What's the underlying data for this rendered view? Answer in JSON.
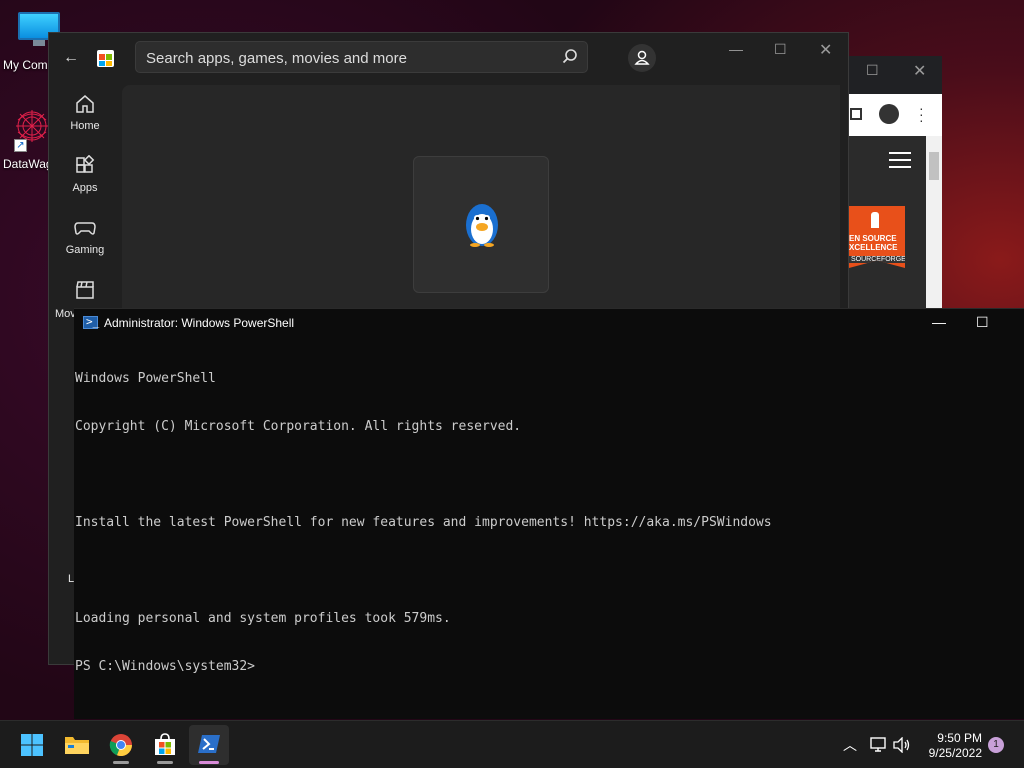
{
  "desktop": {
    "icons": [
      {
        "label": "My Com",
        "icon": "monitor-icon"
      },
      {
        "label": "DataWag",
        "icon": "datawag-icon"
      }
    ]
  },
  "store": {
    "search_placeholder": "Search apps, games, movies and more",
    "nav": [
      {
        "label": "Home",
        "icon": "home-icon"
      },
      {
        "label": "Apps",
        "icon": "apps-icon"
      },
      {
        "label": "Gaming",
        "icon": "gamepad-icon"
      },
      {
        "label": "Mov",
        "icon": "movie-clapper-icon"
      }
    ],
    "app_tile_icon": "penguin-icon",
    "side_fragment_1": "Li"
  },
  "browser": {
    "award_line1": "EN SOURCE",
    "award_line2": "XCELLENCE",
    "award_line3": "SOURCEFORGE"
  },
  "powershell": {
    "title": "Administrator: Windows PowerShell",
    "lines": [
      "Windows PowerShell",
      "Copyright (C) Microsoft Corporation. All rights reserved.",
      "",
      "Install the latest PowerShell for new features and improvements! https://aka.ms/PSWindows",
      "",
      "Loading personal and system profiles took 579ms.",
      "PS C:\\Windows\\system32>"
    ]
  },
  "taskbar": {
    "apps": [
      {
        "name": "start",
        "icon": "windows-start-icon"
      },
      {
        "name": "file-explorer",
        "icon": "folder-icon"
      },
      {
        "name": "chrome",
        "icon": "chrome-icon"
      },
      {
        "name": "microsoft-store",
        "icon": "store-icon"
      },
      {
        "name": "powershell",
        "icon": "powershell-icon"
      }
    ],
    "time": "9:50 PM",
    "date": "9/25/2022",
    "notification_count": "1"
  },
  "colors": {
    "accent_active": "#d88bd8",
    "console_bg": "#0c0c0c",
    "console_text": "#cccccc",
    "sourceforge_orange": "#e8501a"
  }
}
